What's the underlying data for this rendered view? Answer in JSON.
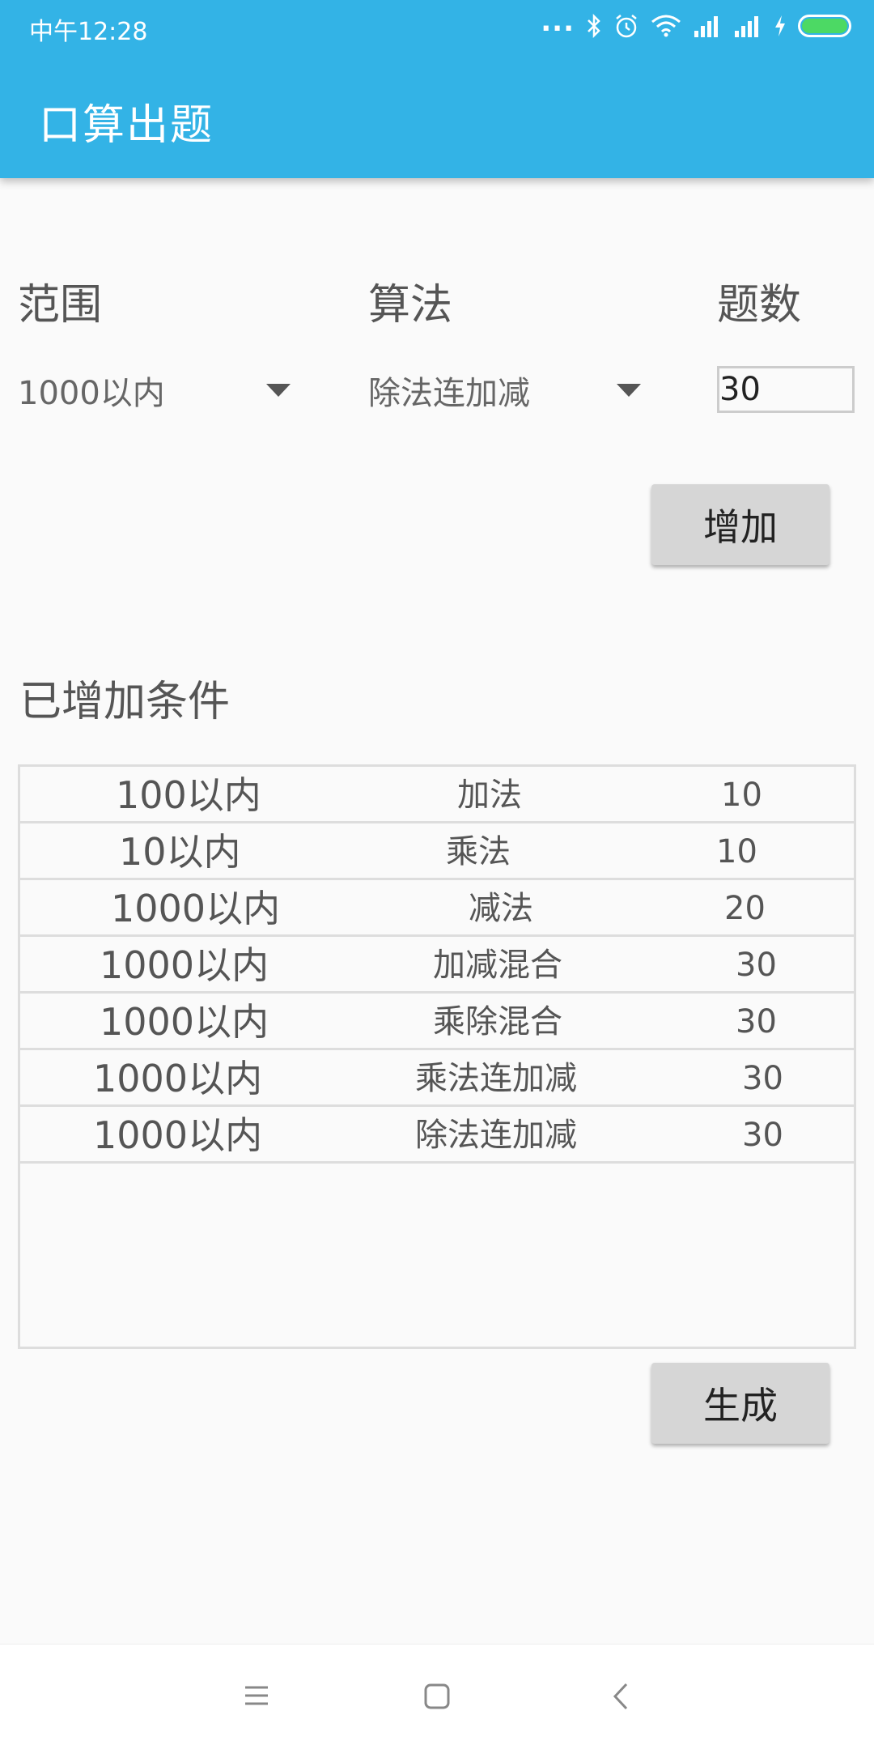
{
  "status": {
    "time": "中午12:28",
    "dots": "..."
  },
  "app": {
    "title": "口算出题"
  },
  "form": {
    "range_label": "范围",
    "op_label": "算法",
    "count_label": "题数",
    "range_value": "1000以内",
    "op_value": "除法连加减",
    "count_value": "30",
    "add_button": "增加"
  },
  "conditions": {
    "title": "已增加条件",
    "rows": [
      {
        "range": "100以内",
        "op": "加法",
        "count": "10"
      },
      {
        "range": "10以内",
        "op": "乘法",
        "count": "10"
      },
      {
        "range": "1000以内",
        "op": "减法",
        "count": "20"
      },
      {
        "range": "1000以内",
        "op": "加减混合",
        "count": "30"
      },
      {
        "range": "1000以内",
        "op": "乘除混合",
        "count": "30"
      },
      {
        "range": "1000以内",
        "op": "乘法连加减",
        "count": "30"
      },
      {
        "range": "1000以内",
        "op": "除法连加减",
        "count": "30"
      }
    ]
  },
  "generate_button": "生成",
  "icons": {
    "statusbar": [
      "bluetooth-icon",
      "alarm-icon",
      "wifi-icon",
      "signal-icon",
      "signal-icon",
      "charging-icon",
      "battery-icon"
    ],
    "nav": [
      "menu-icon",
      "home-icon",
      "back-icon"
    ]
  },
  "colors": {
    "appbar": "#33b3e6",
    "battery": "#4cd964",
    "button": "#d6d6d6"
  }
}
